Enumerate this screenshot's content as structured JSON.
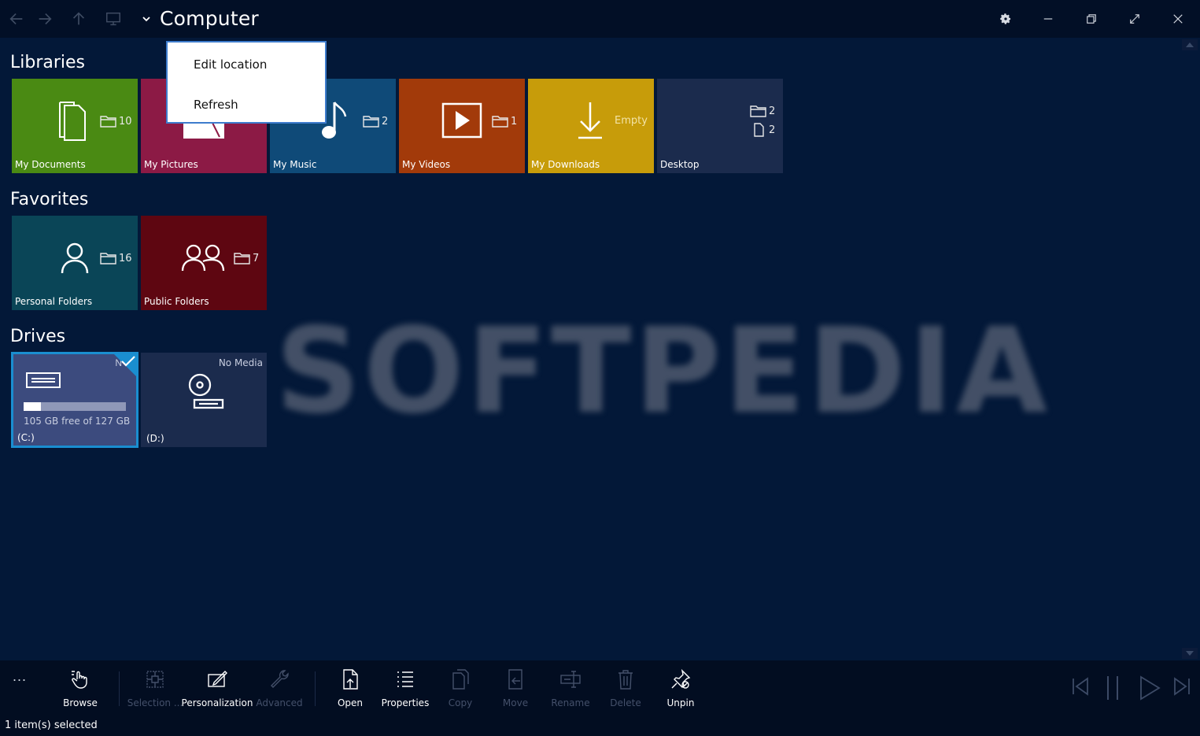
{
  "titlebar": {
    "title": "Computer",
    "icons": [
      "back-arrow-icon",
      "forward-arrow-icon",
      "up-arrow-icon",
      "computer-icon",
      "chevron-down-icon"
    ],
    "window_icons": [
      "gear-icon",
      "minimize-icon",
      "restore-icon",
      "fullscreen-icon",
      "close-icon"
    ]
  },
  "context_menu": {
    "items": [
      "Edit location",
      "Refresh"
    ]
  },
  "libraries": {
    "title": "Libraries",
    "tiles": [
      {
        "label": "My Documents",
        "count": "10",
        "color": "#4a8a13",
        "icon": "documents-icon"
      },
      {
        "label": "My Pictures",
        "count": "",
        "color": "#8c1a45",
        "icon": "pictures-icon"
      },
      {
        "label": "My Music",
        "count": "2",
        "color": "#0f4a78",
        "icon": "music-note-icon"
      },
      {
        "label": "My Videos",
        "count": "1",
        "color": "#a23a0a",
        "icon": "video-play-icon"
      },
      {
        "label": "My Downloads",
        "count": "Empty",
        "color": "#c79c0a",
        "icon": "download-icon"
      },
      {
        "label": "Desktop",
        "folders": "2",
        "files": "2",
        "color": "#1b2b4d",
        "icon": "desktop-icon"
      }
    ]
  },
  "favorites": {
    "title": "Favorites",
    "tiles": [
      {
        "label": "Personal Folders",
        "count": "16",
        "color": "#0a4557",
        "icon": "person-icon"
      },
      {
        "label": "Public Folders",
        "count": "7",
        "color": "#5e0611",
        "icon": "people-icon"
      }
    ]
  },
  "drives": {
    "title": "Drives",
    "tiles": [
      {
        "label": "(C:)",
        "free_text": "105 GB free of 127 GB",
        "used_fraction": 0.17,
        "color": "#3c4b7e",
        "selected": true,
        "corner_text": "N",
        "icon": "hard-drive-icon"
      },
      {
        "label": "(D:)",
        "status": "No Media",
        "color": "#1b2b4d",
        "icon": "optical-drive-icon"
      }
    ]
  },
  "watermark": "SOFTPEDIA",
  "appbar": {
    "more": "...",
    "buttons": [
      {
        "label": "Browse",
        "enabled": true,
        "icon": "hand-pointer-icon"
      },
      {
        "label": "Selection ...",
        "enabled": false,
        "icon": "selection-grid-icon"
      },
      {
        "label": "Personalization",
        "enabled": true,
        "icon": "personalization-icon"
      },
      {
        "label": "Advanced",
        "enabled": false,
        "icon": "wrench-icon"
      },
      {
        "label": "Open",
        "enabled": true,
        "icon": "open-file-icon"
      },
      {
        "label": "Properties",
        "enabled": true,
        "icon": "properties-list-icon"
      },
      {
        "label": "Copy",
        "enabled": false,
        "icon": "copy-icon"
      },
      {
        "label": "Move",
        "enabled": false,
        "icon": "move-icon"
      },
      {
        "label": "Rename",
        "enabled": false,
        "icon": "rename-icon"
      },
      {
        "label": "Delete",
        "enabled": false,
        "icon": "trash-icon"
      },
      {
        "label": "Unpin",
        "enabled": true,
        "icon": "unpin-icon"
      }
    ],
    "media_icons": [
      "skip-previous-icon",
      "pause-icon",
      "play-icon",
      "skip-next-icon"
    ],
    "status": "1 item(s) selected"
  }
}
